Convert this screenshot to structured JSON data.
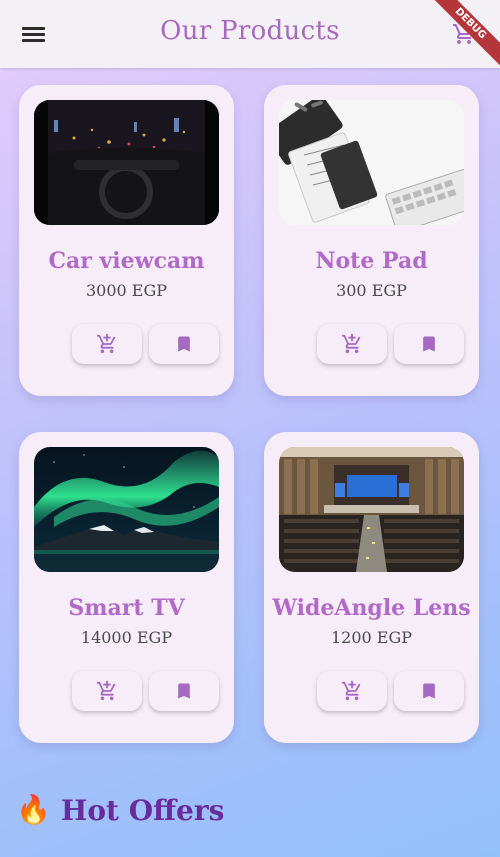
{
  "appbar": {
    "title": "Our Products",
    "debug_label": "DEBUG"
  },
  "products": [
    {
      "name": "Car viewcam",
      "price": "3000 EGP",
      "image": "car-dashboard-night-photo"
    },
    {
      "name": "Note Pad",
      "price": "300 EGP",
      "image": "desk-notepad-keyboard-photo"
    },
    {
      "name": "Smart TV",
      "price": "14000 EGP",
      "image": "aurora-mountains-photo"
    },
    {
      "name": "WideAngle Lens",
      "price": "1200 EGP",
      "image": "conference-hall-photo"
    }
  ],
  "section": {
    "icon": "🔥",
    "title": "Hot Offers"
  },
  "colors": {
    "accent": "#b26ac9",
    "card": "#f7edf9",
    "section_title": "#6a2a9c"
  }
}
